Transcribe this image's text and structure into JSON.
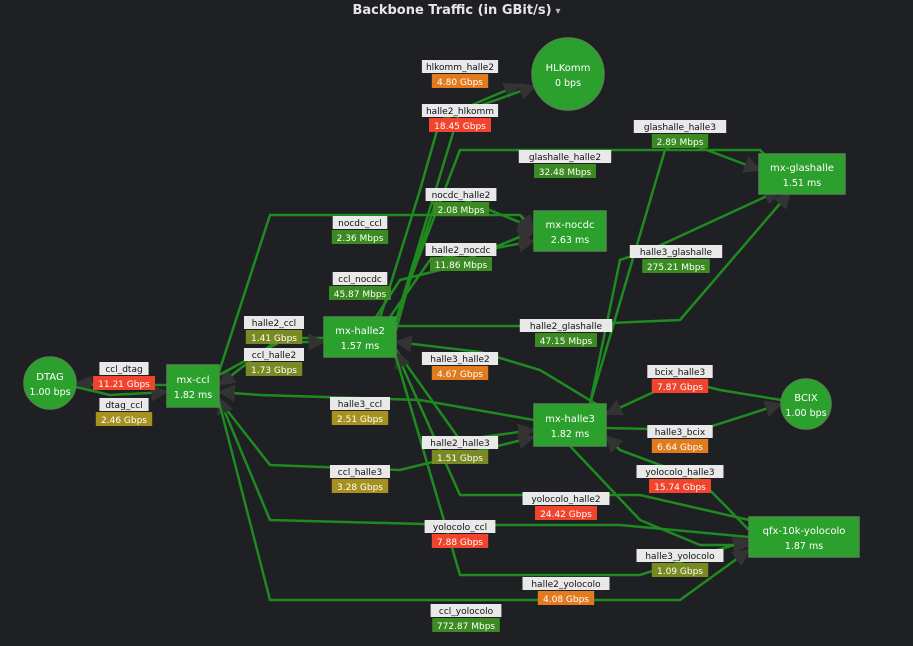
{
  "panel": {
    "title": "Backbone Traffic (in GBit/s)",
    "caret": "▾"
  },
  "colors": {
    "background": "#1f2023",
    "node_fill": "#2ca02c",
    "node_stroke": "#4b8a4b",
    "edge": "#1f8a1f",
    "edge_label_bg": "#e9e9e9",
    "value_green": "#3b8a22",
    "value_olive": "#7a8a22",
    "value_yellow": "#a69020",
    "value_orange": "#e27a1e",
    "value_red": "#f2442d"
  },
  "nodes": [
    {
      "id": "hlkomm",
      "label": "HLKomm",
      "value": "0 bps"
    },
    {
      "id": "mx_glashalle",
      "label": "mx-glashalle",
      "value": "1.51 ms"
    },
    {
      "id": "mx_nocdc",
      "label": "mx-nocdc",
      "value": "2.63 ms"
    },
    {
      "id": "mx_halle2",
      "label": "mx-halle2",
      "value": "1.57 ms"
    },
    {
      "id": "dtag",
      "label": "DTAG",
      "value": "1.00 bps"
    },
    {
      "id": "mx_ccl",
      "label": "mx-ccl",
      "value": "1.82 ms"
    },
    {
      "id": "mx_halle3",
      "label": "mx-halle3",
      "value": "1.82 ms"
    },
    {
      "id": "bcix",
      "label": "BCIX",
      "value": "1.00 bps"
    },
    {
      "id": "qfx",
      "label": "qfx-10k-yolocolo",
      "value": "1.87 ms"
    }
  ],
  "edges": [
    {
      "name": "hlkomm_halle2",
      "value": "4.80 Gbps",
      "level": "orange"
    },
    {
      "name": "halle2_hlkomm",
      "value": "18.45 Gbps",
      "level": "red"
    },
    {
      "name": "glashalle_halle3",
      "value": "2.89 Mbps",
      "level": "green"
    },
    {
      "name": "glashalle_halle2",
      "value": "32.48 Mbps",
      "level": "green"
    },
    {
      "name": "nocdc_halle2",
      "value": "2.08 Mbps",
      "level": "green"
    },
    {
      "name": "nocdc_ccl",
      "value": "2.36 Mbps",
      "level": "green"
    },
    {
      "name": "halle2_nocdc",
      "value": "11.86 Mbps",
      "level": "green"
    },
    {
      "name": "halle3_glashalle",
      "value": "275.21 Mbps",
      "level": "green"
    },
    {
      "name": "ccl_nocdc",
      "value": "45.87 Mbps",
      "level": "green"
    },
    {
      "name": "halle2_ccl",
      "value": "1.41 Gbps",
      "level": "olive"
    },
    {
      "name": "halle2_glashalle",
      "value": "47.15 Mbps",
      "level": "green"
    },
    {
      "name": "ccl_halle2",
      "value": "1.73 Gbps",
      "level": "olive"
    },
    {
      "name": "halle3_halle2",
      "value": "4.67 Gbps",
      "level": "orange"
    },
    {
      "name": "ccl_dtag",
      "value": "11.21 Gbps",
      "level": "red"
    },
    {
      "name": "bcix_halle3",
      "value": "7.87 Gbps",
      "level": "red"
    },
    {
      "name": "dtag_ccl",
      "value": "2.46 Gbps",
      "level": "yellow"
    },
    {
      "name": "halle3_ccl",
      "value": "2.51 Gbps",
      "level": "yellow"
    },
    {
      "name": "halle3_bcix",
      "value": "6.64 Gbps",
      "level": "orange"
    },
    {
      "name": "halle2_halle3",
      "value": "1.51 Gbps",
      "level": "olive"
    },
    {
      "name": "yolocolo_halle3",
      "value": "15.74 Gbps",
      "level": "red"
    },
    {
      "name": "ccl_halle3",
      "value": "3.28 Gbps",
      "level": "yellow"
    },
    {
      "name": "yolocolo_halle2",
      "value": "24.42 Gbps",
      "level": "red"
    },
    {
      "name": "yolocolo_ccl",
      "value": "7.88 Gbps",
      "level": "red"
    },
    {
      "name": "halle3_yolocolo",
      "value": "1.09 Gbps",
      "level": "olive"
    },
    {
      "name": "halle2_yolocolo",
      "value": "4.08 Gbps",
      "level": "orange"
    },
    {
      "name": "ccl_yolocolo",
      "value": "772.87 Mbps",
      "level": "green"
    }
  ]
}
